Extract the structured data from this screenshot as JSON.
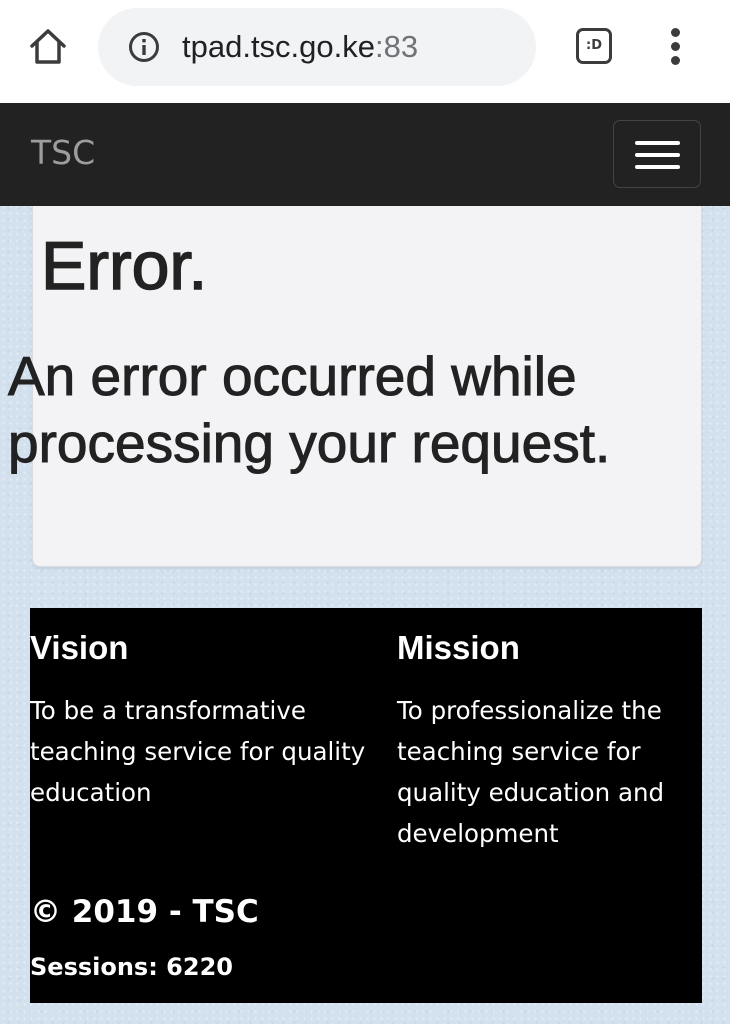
{
  "browser": {
    "url_host": "tpad.tsc.go.ke",
    "url_port": ":83",
    "tabs_label": ":D",
    "icons": {
      "home": "home-icon",
      "info": "info-icon",
      "tabs": "tabs-icon",
      "menu": "more-vert-icon"
    }
  },
  "navbar": {
    "brand": "TSC",
    "toggle_icon": "hamburger-icon",
    "background": "#222222",
    "brand_color": "#9d9d9d"
  },
  "error": {
    "title": "Error.",
    "message": "An error occurred while processing your request."
  },
  "footer": {
    "vision": {
      "heading": "Vision",
      "text": "To be a transformative teaching service for quality education"
    },
    "mission": {
      "heading": "Mission",
      "text": "To professionalize the teaching service for quality education and development"
    },
    "copyright": "© 2019 - TSC",
    "sessions": "Sessions: 6220",
    "background": "#000000"
  }
}
